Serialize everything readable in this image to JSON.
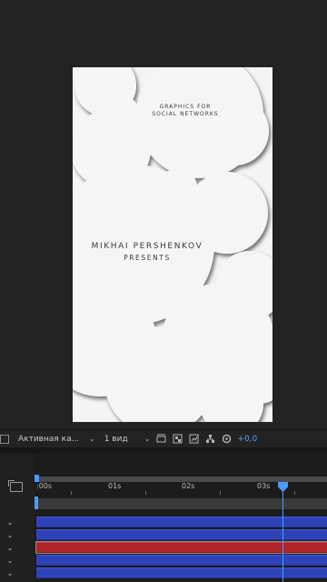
{
  "composition": {
    "line1": "GRAPHICS FOR",
    "line2": "SOCIAL NETWORKS",
    "line3": "MIKHAI PERSHENKOV",
    "line4": "PRESENTS"
  },
  "viewer_bar": {
    "camera_label": "Активная ка...",
    "view_label": "1 вид",
    "exposure_value": "+0,0",
    "icons": [
      "region-of-interest-icon",
      "transparency-grid-icon",
      "toggle-pixel-aspect-icon",
      "flowchart-icon",
      "reset-exposure-icon"
    ]
  },
  "timeline": {
    "ticks": [
      ":00s",
      "01s",
      "02s",
      "03s"
    ],
    "current_time_label": "",
    "layers": [
      {
        "color": "#2f43b8"
      },
      {
        "color": "#2f43b8"
      },
      {
        "color": "#b0242b"
      },
      {
        "color": "#2f43b8"
      },
      {
        "color": "#2f43b8"
      }
    ]
  },
  "colors": {
    "accent": "#4a9cff",
    "layer_blue": "#2f43b8",
    "layer_red": "#b0242b",
    "background": "#232323"
  }
}
